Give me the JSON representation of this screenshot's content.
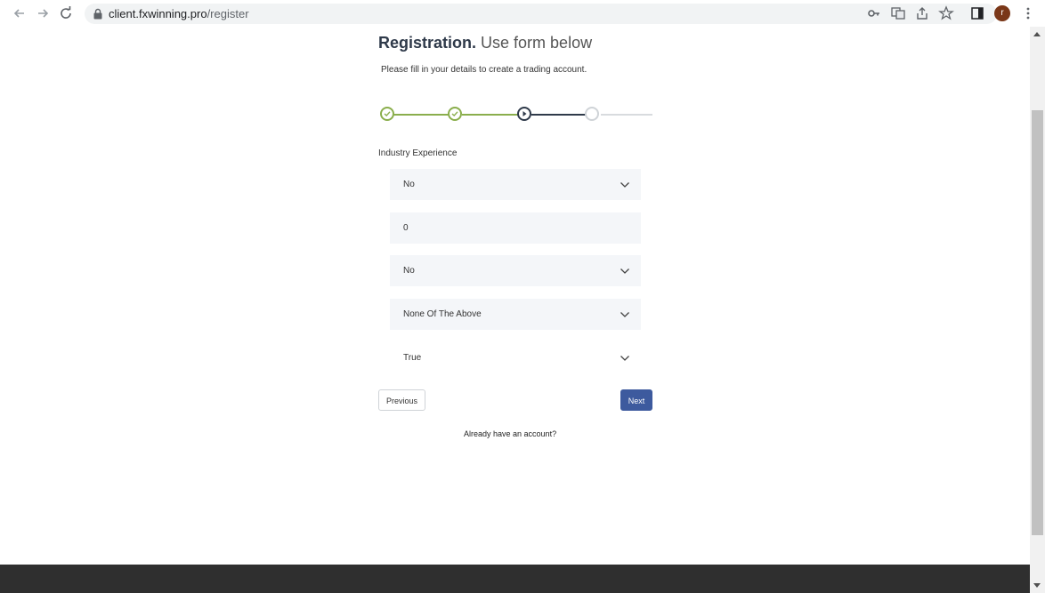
{
  "browser": {
    "url_host": "client.fxwinning.pro",
    "url_path": "/register",
    "avatar_letter": "r"
  },
  "form": {
    "title_bold": "Registration.",
    "title_light": "Use form below",
    "subtitle": "Please fill in your details to create a trading account.",
    "steps": [
      {
        "state": "done"
      },
      {
        "state": "done"
      },
      {
        "state": "current"
      },
      {
        "state": "todo"
      }
    ],
    "section_label": "Industry Experience",
    "fields": [
      {
        "type": "select",
        "value": "No"
      },
      {
        "type": "input",
        "value": "0"
      },
      {
        "type": "select",
        "value": "No"
      },
      {
        "type": "select",
        "value": "None Of The Above"
      },
      {
        "type": "select",
        "value": "True"
      }
    ],
    "previous_label": "Previous",
    "next_label": "Next",
    "login_link": "Already have an account?"
  },
  "colors": {
    "step_done": "#8aae4c",
    "step_current": "#2f3a4a",
    "step_todo": "#cfd3d7",
    "primary_button": "#3d5a9e",
    "field_bg": "#f4f6f9",
    "footer": "#2f2f2f"
  }
}
